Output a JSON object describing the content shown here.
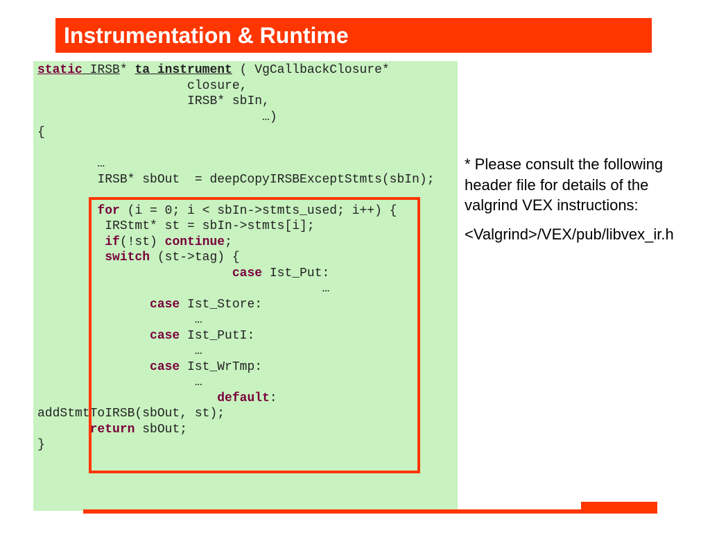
{
  "title": "Instrumentation & Runtime",
  "code": {
    "sig1a": "static",
    "sig1b": " IRSB",
    "sig1c": "* ",
    "sig1d": "ta_instrument",
    "sig1e": " ( VgCallbackClosure*",
    "sig2": "                    closure,",
    "sig3": "                    IRSB* sbIn,",
    "sig4": "                              …)",
    "open": "{",
    "body1": "        …",
    "body2": "        IRSB* sbOut  = deepCopyIRSBExceptStmts(sbIn);",
    "blank": "",
    "for_kw": "for",
    "for_rest": " (i = 0; i < sbIn->stmts_used; i++) {",
    "stline": "         IRStmt* st = sbIn->stmts[i];",
    "if_kw": "if",
    "if_mid": "(!st) ",
    "cont_kw": "continue",
    "semi": ";",
    "switch_kw": "switch",
    "switch_rest": " (st->tag) {",
    "case_kw": "case",
    "case1_rest": " Ist_Put:",
    "dots": "…",
    "case2_rest": " Ist_Store:",
    "case3_rest": " Ist_PutI:",
    "case4_rest": " Ist_WrTmp:",
    "default_kw": "default",
    "default_rest": ":",
    "addline": "addStmtToIRSB(sbOut, st);",
    "return_kw": "return",
    "return_rest": " sbOut;",
    "close": "}"
  },
  "note": {
    "text": "* Please consult the following header file for details of the valgrind VEX instructions:",
    "path": "<Valgrind>/VEX/pub/libvex_ir.h"
  }
}
